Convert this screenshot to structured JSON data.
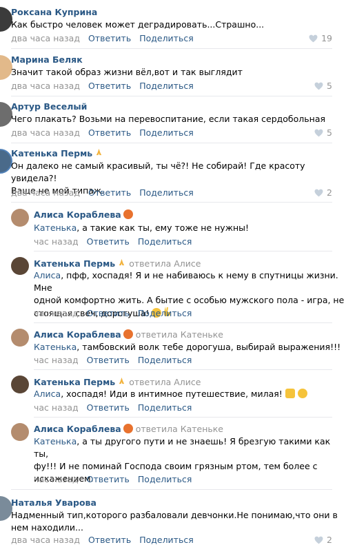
{
  "comments": [
    {
      "author": "Роксана Куприна",
      "text": "Как быстро человек может деградировать...Страшно...",
      "time": "два часа назад",
      "reply": "Ответить",
      "share": "Поделиться",
      "likes": "19"
    },
    {
      "author": "Марина Беляк",
      "text": "Значит такой образ жизни вёл,вот и так выглядит",
      "time": "два часа назад",
      "reply": "Ответить",
      "share": "Поделиться",
      "likes": "5"
    },
    {
      "author": "Артур Веселый",
      "text": "Чего плакать? Возьми на перевоспитание, если такая сердобольная",
      "time": "два часа назад",
      "reply": "Ответить",
      "share": "Поделиться",
      "likes": "5"
    },
    {
      "author": "Катенька Пермь",
      "text_line1": "Он далеко не самый красивый, ты чё?! Не собирай! Где красоту увидела?!",
      "text_line2": "Ваще не мой типаж.",
      "time": "два часа назад",
      "reply": "Ответить",
      "share": "Поделиться",
      "likes": "2"
    }
  ],
  "replies": [
    {
      "author": "Алиса Кораблева",
      "mention": "Катенька",
      "text": ", а такие как ты, ему тоже не нужны!",
      "time": "час назад",
      "reply": "Ответить",
      "share": "Поделиться"
    },
    {
      "author": "Катенька Пермь",
      "answered": "ответила Алисе",
      "mention": "Алиса",
      "text_line1": ", пфф, хоспадя! Я и не набиваюсь к нему в спутницы жизни. Мне",
      "text_line2": "одной комфортно жить. А бытие с особью мужского пола - игра, не",
      "text_line3": "стоящая свеч, дорогуша!",
      "time": "час назад",
      "reply": "Ответить",
      "share": "Поделиться"
    },
    {
      "author": "Алиса Кораблева",
      "answered": "ответила Катеньке",
      "mention": "Катенька",
      "text": ", тамбовский волк тебе дорогуша, выбирай выражения!!!",
      "time": "час назад",
      "reply": "Ответить",
      "share": "Поделиться"
    },
    {
      "author": "Катенька Пермь",
      "answered": "ответила Алисе",
      "mention": "Алиса",
      "text": ", хоспадя! Иди в интимное путешествие, милая!",
      "time": "час назад",
      "reply": "Ответить",
      "share": "Поделиться"
    },
    {
      "author": "Алиса Кораблева",
      "answered": "ответила Катеньке",
      "mention": "Катенька",
      "text_line1": ", а ты другого пути и не знаешь! Я брезгую такими как ты,",
      "text_line2": "фу!!! И не поминай Господа своим грязным ртом, тем более с",
      "text_line3": "искажением.",
      "time": "час назад",
      "reply": "Ответить",
      "share": "Поделиться"
    }
  ],
  "last": {
    "author": "Наталья Уварова",
    "text_line1": "Надменный тип,которого разбаловали девчонки.Не понимаю,что они в",
    "text_line2": "нем находили...",
    "time": "два часа назад",
    "reply": "Ответить",
    "share": "Поделиться",
    "likes": "2"
  },
  "colors": {
    "link": "#2a5885",
    "meta": "#939393",
    "separator": "#e7e8ec"
  }
}
